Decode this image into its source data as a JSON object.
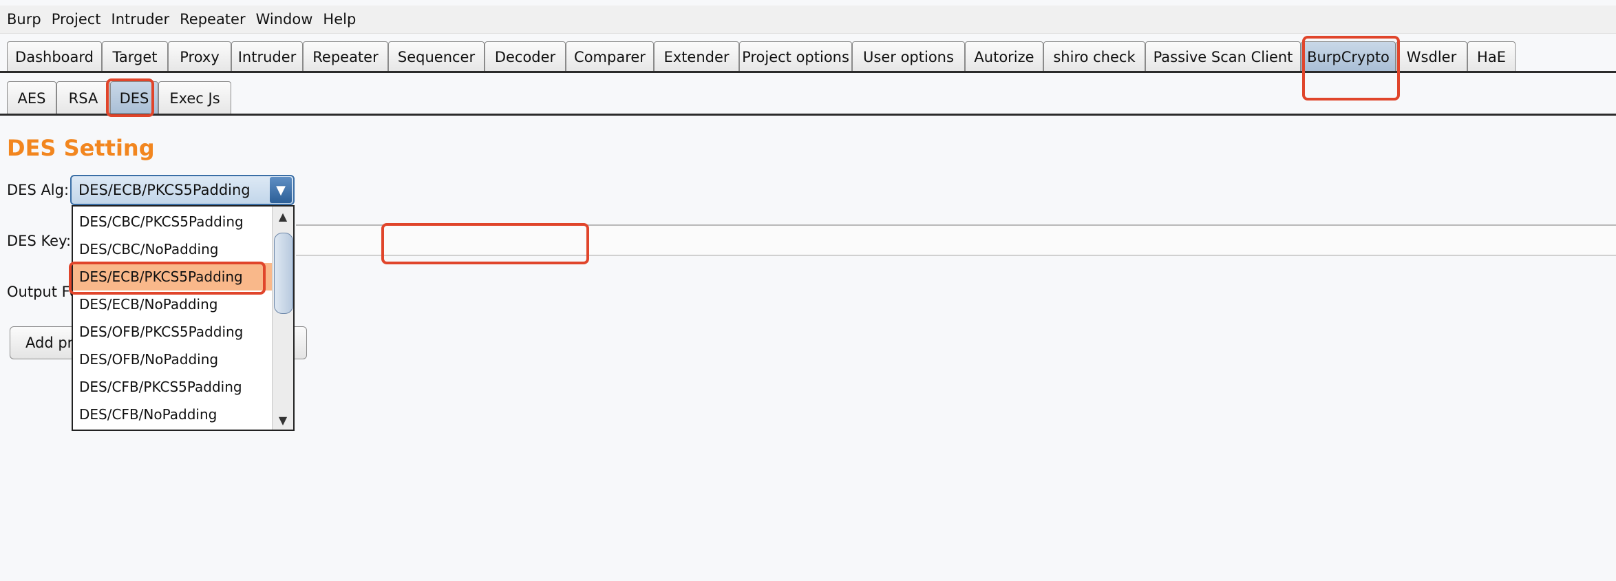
{
  "menubar": {
    "items": [
      "Burp",
      "Project",
      "Intruder",
      "Repeater",
      "Window",
      "Help"
    ]
  },
  "main_tabs": [
    "Dashboard",
    "Target",
    "Proxy",
    "Intruder",
    "Repeater",
    "Sequencer",
    "Decoder",
    "Comparer",
    "Extender",
    "Project options",
    "User options",
    "Autorize",
    "shiro check",
    "Passive Scan Client",
    "BurpCrypto",
    "Wsdler",
    "HaE"
  ],
  "main_tabs_active": "BurpCrypto",
  "sub_tabs": [
    "AES",
    "RSA",
    "DES",
    "Exec Js"
  ],
  "sub_tabs_active": "DES",
  "des": {
    "title": "DES Setting",
    "alg_label": "DES Alg:",
    "alg_selected": "DES/ECB/PKCS5Padding",
    "key_label": "DES Key:",
    "key_value": "",
    "output_label_visible": "Output Fo",
    "button_label_visible": "Add pr",
    "options": [
      "DES/CBC/PKCS5Padding",
      "DES/CBC/NoPadding",
      "DES/ECB/PKCS5Padding",
      "DES/ECB/NoPadding",
      "DES/OFB/PKCS5Padding",
      "DES/OFB/NoPadding",
      "DES/CFB/PKCS5Padding",
      "DES/CFB/NoPadding"
    ]
  },
  "colors": {
    "title": "#f2861f",
    "highlight": "#e0452b",
    "selected_option": "#f9b88a",
    "active_tab": "#b2c6db"
  },
  "icons": {
    "dropdown_arrow": "chevron-down-icon",
    "scroll_up": "scroll-up-icon",
    "scroll_down": "scroll-down-icon"
  }
}
